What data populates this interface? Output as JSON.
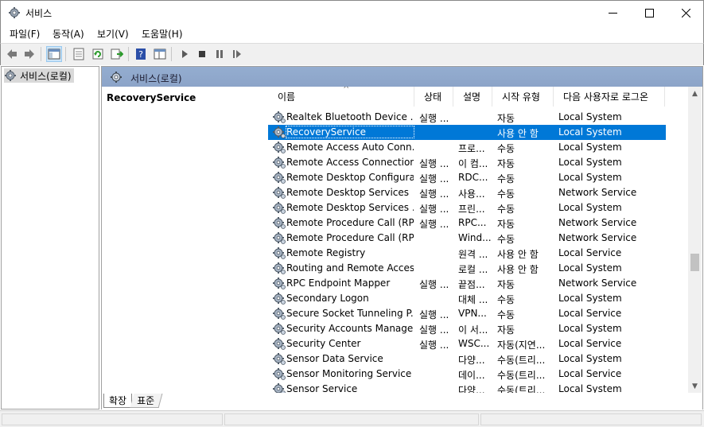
{
  "window": {
    "title": "서비스",
    "controls": [
      "minimize-icon",
      "maximize-icon",
      "close-icon"
    ]
  },
  "menu": {
    "items": [
      "파일(F)",
      "동작(A)",
      "보기(V)",
      "도움말(H)"
    ]
  },
  "toolbar": {
    "icons": [
      "back-arrow-icon",
      "forward-arrow-icon",
      "show-hide-tree-icon",
      "properties-icon",
      "refresh-icon",
      "export-list-icon",
      "help-icon",
      "view-icon",
      "start-service-icon",
      "stop-service-icon",
      "pause-service-icon",
      "restart-service-icon"
    ]
  },
  "tree": {
    "root_label": "서비스(로컬)"
  },
  "content": {
    "header_title": "서비스(로컬)",
    "selected_service_title": "RecoveryService"
  },
  "list": {
    "columns": [
      "이름",
      "상태",
      "설명",
      "시작 유형",
      "다음 사용자로 로그온"
    ],
    "rows": [
      {
        "name": "Realtek Bluetooth Device ...",
        "status": "실행 ...",
        "desc": "",
        "startup": "자동",
        "logon": "Local System"
      },
      {
        "name": "RecoveryService",
        "status": "",
        "desc": "",
        "startup": "사용 안 함",
        "logon": "Local System",
        "selected": true
      },
      {
        "name": "Remote Access Auto Conn...",
        "status": "",
        "desc": "프로...",
        "startup": "수동",
        "logon": "Local System"
      },
      {
        "name": "Remote Access Connection...",
        "status": "실행 ...",
        "desc": "이 컴...",
        "startup": "자동",
        "logon": "Local System"
      },
      {
        "name": "Remote Desktop Configura...",
        "status": "실행 ...",
        "desc": "RDC...",
        "startup": "수동",
        "logon": "Local System"
      },
      {
        "name": "Remote Desktop Services",
        "status": "실행 ...",
        "desc": "사용...",
        "startup": "수동",
        "logon": "Network Service"
      },
      {
        "name": "Remote Desktop Services ...",
        "status": "실행 ...",
        "desc": "프린...",
        "startup": "수동",
        "logon": "Local System"
      },
      {
        "name": "Remote Procedure Call (RP...",
        "status": "실행 ...",
        "desc": "RPC...",
        "startup": "자동",
        "logon": "Network Service"
      },
      {
        "name": "Remote Procedure Call (RP...",
        "status": "",
        "desc": "Wind...",
        "startup": "수동",
        "logon": "Network Service"
      },
      {
        "name": "Remote Registry",
        "status": "",
        "desc": "원격 ...",
        "startup": "사용 안 함",
        "logon": "Local Service"
      },
      {
        "name": "Routing and Remote Access",
        "status": "",
        "desc": "로컬 ...",
        "startup": "사용 안 함",
        "logon": "Local System"
      },
      {
        "name": "RPC Endpoint Mapper",
        "status": "실행 ...",
        "desc": "끝점...",
        "startup": "자동",
        "logon": "Network Service"
      },
      {
        "name": "Secondary Logon",
        "status": "",
        "desc": "대체 ...",
        "startup": "수동",
        "logon": "Local System"
      },
      {
        "name": "Secure Socket Tunneling P...",
        "status": "실행 ...",
        "desc": "VPN...",
        "startup": "수동",
        "logon": "Local Service"
      },
      {
        "name": "Security Accounts Manager",
        "status": "실행 ...",
        "desc": "이 서...",
        "startup": "자동",
        "logon": "Local System"
      },
      {
        "name": "Security Center",
        "status": "실행 ...",
        "desc": "WSC...",
        "startup": "자동(지연...",
        "logon": "Local Service"
      },
      {
        "name": "Sensor Data Service",
        "status": "",
        "desc": "다양...",
        "startup": "수동(트리...",
        "logon": "Local System"
      },
      {
        "name": "Sensor Monitoring Service",
        "status": "",
        "desc": "데이...",
        "startup": "수동(트리...",
        "logon": "Local Service"
      },
      {
        "name": "Sensor Service",
        "status": "",
        "desc": "다양...",
        "startup": "수동(트리...",
        "logon": "Local System"
      }
    ]
  },
  "tabs": [
    "확장",
    "표준"
  ],
  "colors": {
    "selection": "#0078d7",
    "pane_header": "#8ca4c8"
  }
}
